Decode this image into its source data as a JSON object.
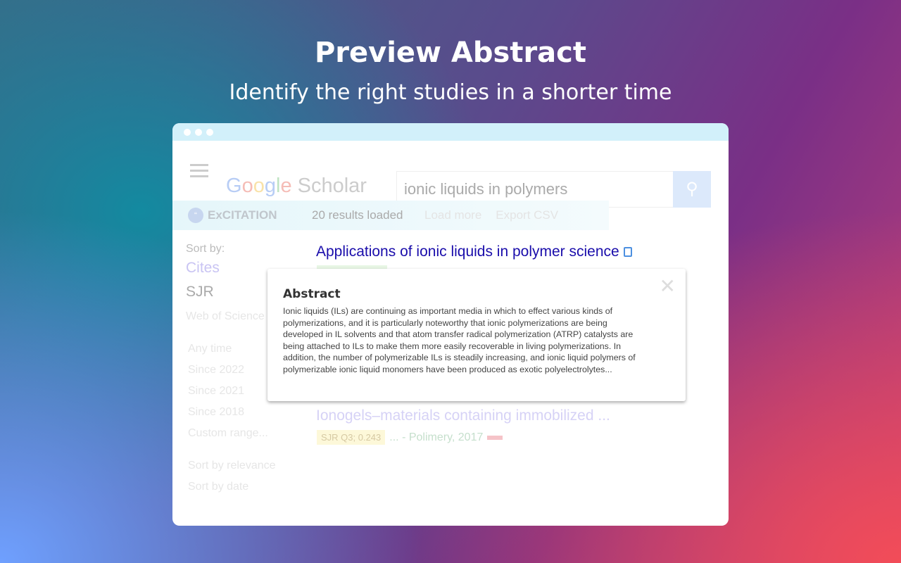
{
  "hero": {
    "title": "Preview Abstract",
    "subtitle": "Identify the right studies in a shorter time"
  },
  "scholar": {
    "logo": "Google Scholar",
    "search_value": "ionic liquids in polymers"
  },
  "excitation": {
    "name": "ExCITATION",
    "results_loaded": "20 results loaded",
    "load_more": "Load more",
    "export_csv": "Export CSV"
  },
  "sidebar": {
    "sort_by": "Sort by:",
    "cites": "Cites",
    "sjr": "SJR",
    "wos": "Web of Science",
    "filters": [
      "Any time",
      "Since 2022",
      "Since 2021",
      "Since 2018",
      "Custom range..."
    ],
    "sort_relevance": "Sort by relevance",
    "sort_date": "Sort by date"
  },
  "results": [
    {
      "title": "Applications of ionic liquids in polymer science"
    },
    {
      "title": "Ionogels–materials containing immobilized ...",
      "badge": "SJR Q3; 0.243",
      "meta": "... - Polimery, 2017"
    }
  ],
  "abstract": {
    "heading": "Abstract",
    "text": "Ionic liquids (ILs) are continuing as important media in which to effect various kinds of polymerizations, and it is particularly noteworthy that ionic polymerizations are being developed in IL solvents and that atom transfer radical polymerization (ATRP) catalysts are being attached to ILs to make them more easily recoverable in living polymerizations. In addition, the number of polymerizable ILs is steadily increasing, and ionic liquid polymers of polymerizable ionic liquid monomers have been produced as exotic polyelectrolytes..."
  }
}
